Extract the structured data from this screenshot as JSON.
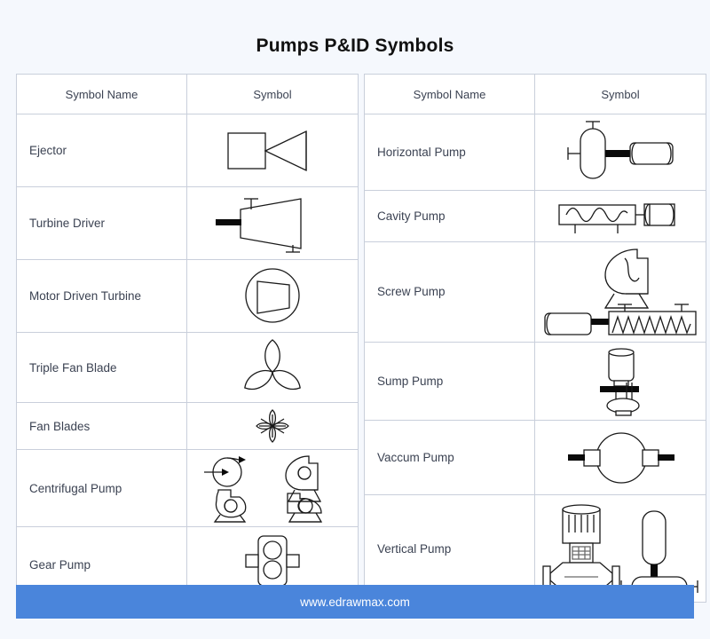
{
  "header": {
    "title": "Pumps P&ID Symbols"
  },
  "tables": [
    {
      "id": "left-table",
      "columns": [
        "Symbol Name",
        "Symbol"
      ],
      "rows": [
        {
          "name": "Ejector",
          "symbol": "ejector-symbol"
        },
        {
          "name": "Turbine Driver",
          "symbol": "turbine-driver-symbol"
        },
        {
          "name": "Motor Driven Turbine",
          "symbol": "motor-driven-turbine-symbol"
        },
        {
          "name": "Triple Fan Blade",
          "symbol": "triple-fan-blade-symbol"
        },
        {
          "name": "Fan Blades",
          "symbol": "fan-blades-symbol"
        },
        {
          "name": "Centrifugal Pump",
          "symbol": "centrifugal-pump-symbol"
        },
        {
          "name": "Gear Pump",
          "symbol": "gear-pump-symbol"
        }
      ]
    },
    {
      "id": "right-table",
      "columns": [
        "Symbol Name",
        "Symbol"
      ],
      "rows": [
        {
          "name": "Horizontal Pump",
          "symbol": "horizontal-pump-symbol"
        },
        {
          "name": "Cavity Pump",
          "symbol": "cavity-pump-symbol"
        },
        {
          "name": "Screw Pump",
          "symbol": "screw-pump-symbol"
        },
        {
          "name": "Sump Pump",
          "symbol": "sump-pump-symbol"
        },
        {
          "name": "Vaccum Pump",
          "symbol": "vaccum-pump-symbol"
        },
        {
          "name": "Vertical Pump",
          "symbol": "vertical-pump-symbol"
        }
      ]
    }
  ],
  "footer": {
    "url": "www.edrawmax.com"
  },
  "colors": {
    "page_background": "#f5f8fd",
    "card_background": "#ffffff",
    "border": "#c9cfdb",
    "text": "#3b4252",
    "title": "#111111",
    "footer_bar": "#4a85db",
    "footer_text": "#ffffff",
    "line": "#1a1a1a"
  }
}
